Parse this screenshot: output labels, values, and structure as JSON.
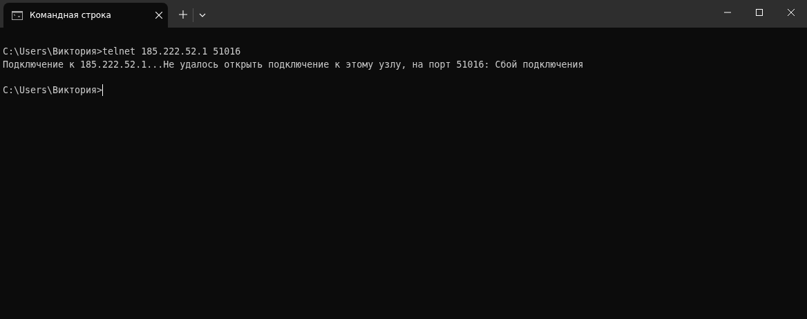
{
  "tab": {
    "title": "Командная строка",
    "selected": true
  },
  "console": {
    "lines": [
      {
        "text": "C:\\Users\\Виктория>telnet 185.222.52.1 51016",
        "gap_before": false,
        "cursor": false
      },
      {
        "text": "Подключение к 185.222.52.1...Не удалось открыть подключение к этому узлу, на порт 51016: Сбой подключения",
        "gap_before": false,
        "cursor": false
      },
      {
        "text": "C:\\Users\\Виктория>",
        "gap_before": true,
        "cursor": true
      }
    ]
  }
}
